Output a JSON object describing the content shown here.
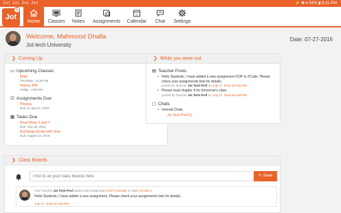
{
  "status_bar": {
    "left_icons": "Jot Jot Jot Jot",
    "right": "⚡ ✱ ▾ 61% ▮ 6:11 PM"
  },
  "app": {
    "logo_text": "Jot",
    "logo_badge": "5"
  },
  "nav": {
    "items": [
      {
        "label": "Home",
        "icon": "home-icon"
      },
      {
        "label": "Classes",
        "icon": "classes-icon"
      },
      {
        "label": "Notes",
        "icon": "notes-icon"
      },
      {
        "label": "Assignments",
        "icon": "assignments-icon"
      },
      {
        "label": "Calendar",
        "icon": "calendar-icon"
      },
      {
        "label": "Chat",
        "icon": "chat-icon"
      },
      {
        "label": "Settings",
        "icon": "gear-icon"
      }
    ]
  },
  "welcome": {
    "greeting": "Welcome, Mahmood Dhalla",
    "school": "Jot-tech University",
    "date": "Date: 07-27-2016"
  },
  "coming_up": {
    "title": "Coming Up",
    "upcoming_classes": {
      "title": "Upcoming Classes",
      "items": [
        {
          "name": "Math",
          "when": "Thursday , 11:30 AM"
        },
        {
          "name": "History 404",
          "when": "Friday , 2:00 PM"
        }
      ]
    },
    "assignments_due": {
      "title": "Assignments Due",
      "items": [
        {
          "name": "Physics",
          "when": "Due on July 27, 2016"
        }
      ]
    },
    "tasks_due": {
      "title": "Tasks Due",
      "items": [
        {
          "name": "Read Book X and Y",
          "when": "Due: July 28, 2016"
        },
        {
          "name": "Exchange books with Jess",
          "when": "Due: August 12, 2016"
        }
      ]
    }
  },
  "while_out": {
    "title": "While you were out",
    "teacher_posts": {
      "title": "Teacher Posts",
      "posts": [
        {
          "text1": "Hello Students, I have added a new assignment OOP in ZCode. Please",
          "text2": "check your assignments lists for details.",
          "posted_by": "posted by Teacher",
          "who": "Jot Tech Prof",
          "on": "on",
          "time": "July 27, 2016 at 6:09 PM"
        },
        {
          "text1": "Please read chapter 4 for tomorrow's class",
          "text2": "",
          "posted_by": "posted by Teacher",
          "who": "Jot Tech Prof",
          "on": "on",
          "time": "July 27, 2016 at 6:03 PM"
        }
      ]
    },
    "chats": {
      "title": "Chats",
      "unread_label": "Unread Chats",
      "unread_item": "Jot Tech Prof (1)"
    }
  },
  "class_boards": {
    "title": "Class Boards",
    "input_placeholder": "Post to all your class boards here",
    "save_label": "Save",
    "feed": {
      "p1": "Your Teacher",
      "who": "Jot Tech Prof",
      "p2": "added new Assignment",
      "assignment": "OOP in ZCode",
      "p3": "in Class",
      "class": "XCode 6",
      "message": "Hello Students, I have added a new assignment. Please check your assignments lists for details.",
      "time": "July 27, 2016 at 6:09 PM"
    }
  },
  "colors": {
    "accent": "#e8622a",
    "header_bg": "#f0f0f0"
  }
}
